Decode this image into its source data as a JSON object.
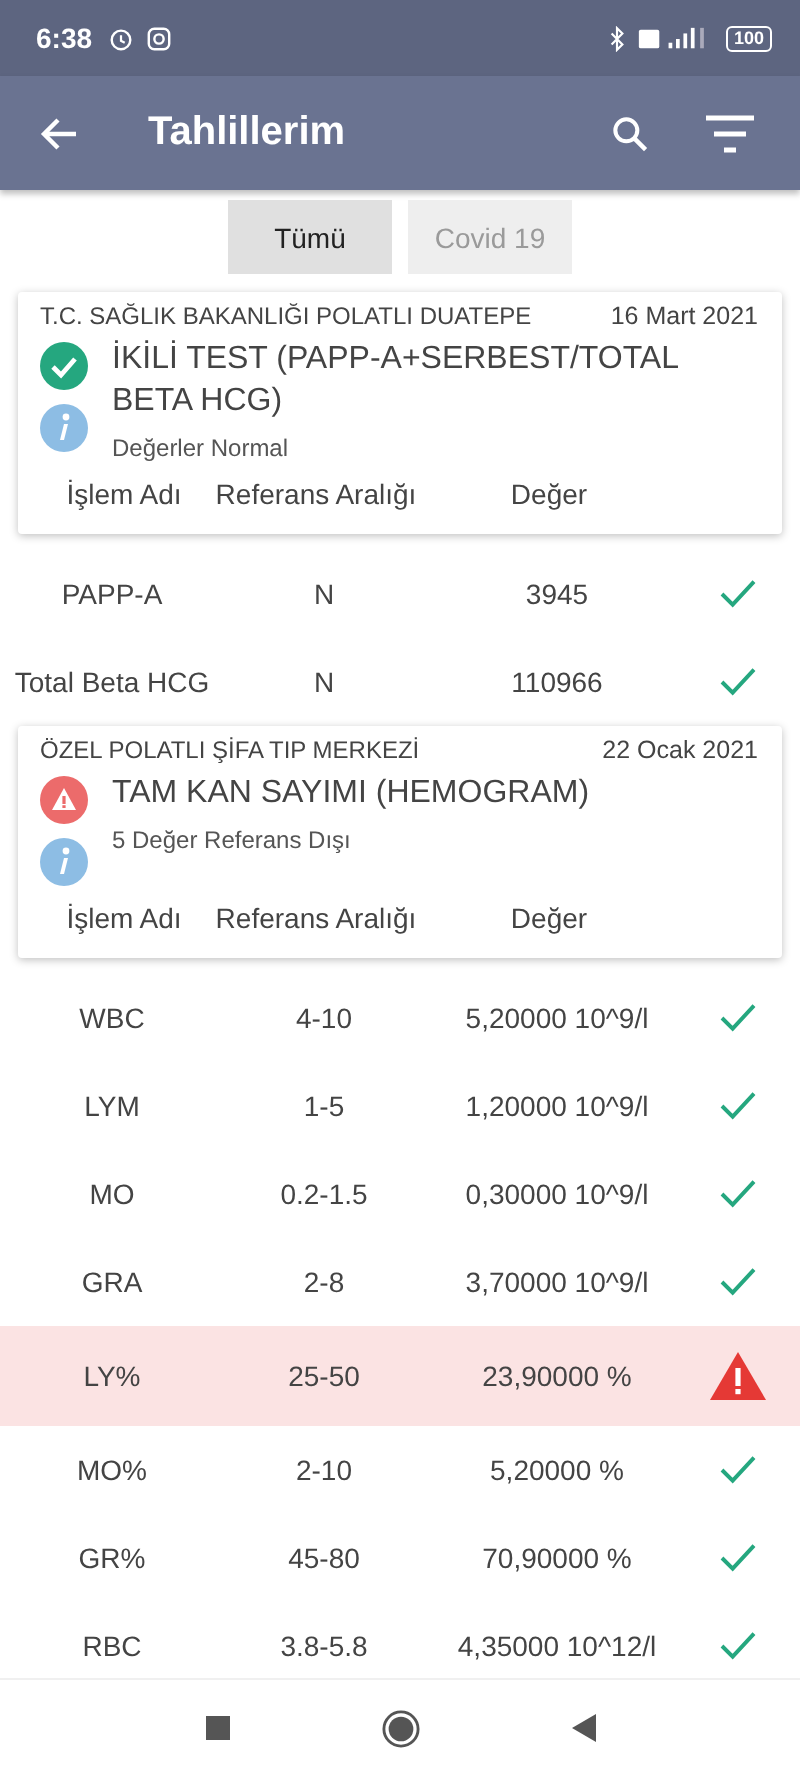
{
  "status_bar": {
    "time": "6:38",
    "battery": "100"
  },
  "app_bar": {
    "title": "Tahlillerim"
  },
  "tabs": [
    {
      "label": "Tümü",
      "selected": true
    },
    {
      "label": "Covid 19",
      "selected": false
    }
  ],
  "reports": [
    {
      "institution": "T.C. SAĞLIK BAKANLIĞI POLATLI DUATEPE",
      "date": "16 Mart 2021",
      "kind": "ok",
      "title": "İKİLİ TEST (PAPP-A+SERBEST/TOTAL BETA HCG)",
      "summary": "Değerler Normal",
      "columns": [
        "İşlem Adı",
        "Referans Aralığı",
        "Değer"
      ],
      "rows": [
        {
          "name": "PAPP-A",
          "range": "N",
          "value": "3945",
          "kind": "normal"
        },
        {
          "name": "Total Beta HCG",
          "range": "N",
          "value": "110966",
          "kind": "normal"
        }
      ]
    },
    {
      "institution": "ÖZEL POLATLI ŞİFA TIP MERKEZİ",
      "date": "22 Ocak 2021",
      "kind": "warning",
      "title": "TAM KAN SAYIMI (HEMOGRAM)",
      "summary": "5 Değer Referans Dışı",
      "columns": [
        "İşlem Adı",
        "Referans Aralığı",
        "Değer"
      ],
      "rows": [
        {
          "name": "WBC",
          "range": "4-10",
          "value": "5,20000 10^9/l",
          "kind": "normal"
        },
        {
          "name": "LYM",
          "range": "1-5",
          "value": "1,20000 10^9/l",
          "kind": "normal"
        },
        {
          "name": "MO",
          "range": "0.2-1.5",
          "value": "0,30000 10^9/l",
          "kind": "normal"
        },
        {
          "name": "GRA",
          "range": "2-8",
          "value": "3,70000 10^9/l",
          "kind": "normal"
        },
        {
          "name": "LY%",
          "range": "25-50",
          "value": "23,90000 %",
          "kind": "abnormal"
        },
        {
          "name": "MO%",
          "range": "2-10",
          "value": "5,20000 %",
          "kind": "normal"
        },
        {
          "name": "GR%",
          "range": "45-80",
          "value": "70,90000 %",
          "kind": "normal"
        },
        {
          "name": "RBC",
          "range": "3.8-5.8",
          "value": "4,35000 10^12/l",
          "kind": "normal"
        }
      ]
    }
  ]
}
